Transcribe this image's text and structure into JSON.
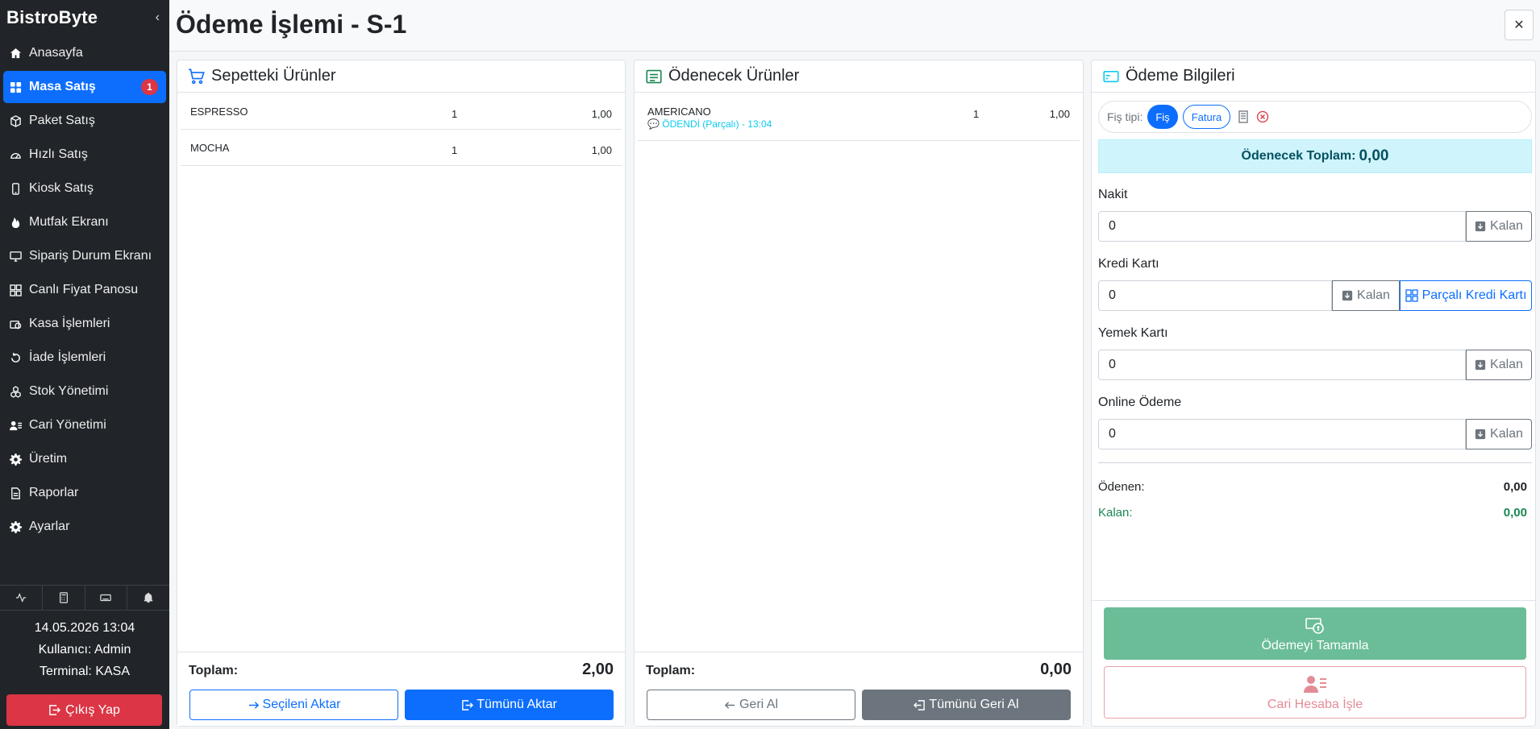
{
  "sidebar": {
    "brand": "BistroByte",
    "items": [
      {
        "label": "Anasayfa"
      },
      {
        "label": "Masa Satış",
        "badge": "1"
      },
      {
        "label": "Paket Satış"
      },
      {
        "label": "Hızlı Satış"
      },
      {
        "label": "Kiosk Satış"
      },
      {
        "label": "Mutfak Ekranı"
      },
      {
        "label": "Sipariş Durum Ekranı"
      },
      {
        "label": "Canlı Fiyat Panosu"
      },
      {
        "label": "Kasa İşlemleri"
      },
      {
        "label": "İade İşlemleri"
      },
      {
        "label": "Stok Yönetimi"
      },
      {
        "label": "Cari Yönetimi"
      },
      {
        "label": "Üretim"
      },
      {
        "label": "Raporlar"
      },
      {
        "label": "Ayarlar"
      }
    ],
    "datetime": "14.05.2026  13:04",
    "user": "Kullanıcı: Admin",
    "terminal": "Terminal: KASA",
    "logout": "Çıkış Yap"
  },
  "header": {
    "title": "Ödeme İşlemi - S-1",
    "close": "✕"
  },
  "cart": {
    "title": "Sepetteki Ürünler",
    "rows": [
      {
        "name": "ESPRESSO",
        "qty": "1",
        "price": "1,00"
      },
      {
        "name": "MOCHA",
        "qty": "1",
        "price": "1,00"
      }
    ],
    "total_label": "Toplam:",
    "total_value": "2,00",
    "transfer_selected": "Seçileni Aktar",
    "transfer_all": "Tümünü Aktar"
  },
  "paying": {
    "title": "Ödenecek Ürünler",
    "rows": [
      {
        "name": "AMERICANO",
        "status": "ÖDENDİ (Parçalı) - 13:04",
        "qty": "1",
        "price": "1,00"
      }
    ],
    "total_label": "Toplam:",
    "total_value": "0,00",
    "undo": "Geri Al",
    "undo_all": "Tümünü Geri Al"
  },
  "payment": {
    "title": "Ödeme Bilgileri",
    "receipt_label": "Fiş tipi:",
    "receipt_options": [
      "Fiş",
      "Fatura"
    ],
    "due_label": "Ödenecek Toplam:",
    "due_value": "0,00",
    "fields": [
      {
        "label": "Nakit",
        "value": "0",
        "button": "Kalan"
      },
      {
        "label": "Kredi Kartı",
        "value": "0",
        "button": "Kalan",
        "extra_button": "Parçalı Kredi Kartı"
      },
      {
        "label": "Yemek Kartı",
        "value": "0",
        "button": "Kalan"
      },
      {
        "label": "Online Ödeme",
        "value": "0",
        "button": "Kalan"
      }
    ],
    "paid_label": "Ödenen:",
    "paid_value": "0,00",
    "remaining_label": "Kalan:",
    "remaining_value": "0,00",
    "complete": "Ödemeyi Tamamla",
    "account": "Cari Hesaba İşle"
  },
  "colors": {
    "primary": "#0d6efd",
    "danger": "#dc3545",
    "success_text": "#198754",
    "info_text": "#0dcaf0"
  }
}
